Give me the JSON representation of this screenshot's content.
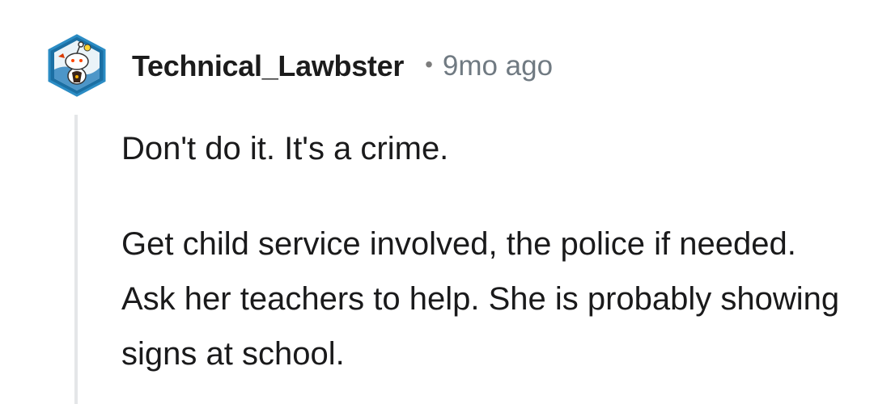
{
  "comment": {
    "author": "Technical_Lawbster",
    "separator": "•",
    "timestamp": "9mo ago",
    "paragraphs": [
      "Don't do it. It's a crime.",
      "Get child service involved, the police if needed. Ask her teachers to help. She is probably showing signs at school."
    ],
    "avatar_icon": "snoo-avatar-icon"
  },
  "colors": {
    "username": "#1c1c1c",
    "timestamp": "#707a82",
    "body_text": "#1a1a1b",
    "thread_line": "#e4e6e8",
    "avatar_border": "#2b8cc4"
  }
}
